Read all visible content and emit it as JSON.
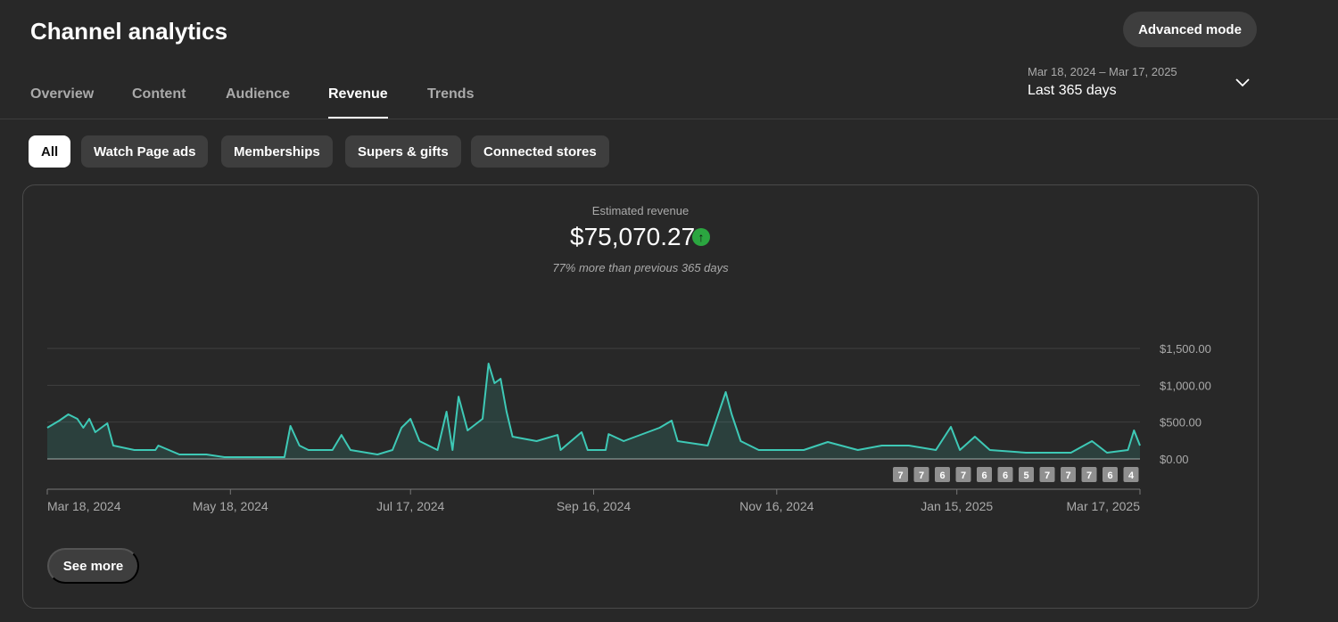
{
  "header": {
    "title": "Channel analytics",
    "advanced_mode": "Advanced mode"
  },
  "tabs": [
    "Overview",
    "Content",
    "Audience",
    "Revenue",
    "Trends"
  ],
  "active_tab": "Revenue",
  "date_range": {
    "dates": "Mar 18, 2024 – Mar 17, 2025",
    "label": "Last 365 days"
  },
  "filters": [
    "All",
    "Watch Page ads",
    "Memberships",
    "Supers & gifts",
    "Connected stores"
  ],
  "metric": {
    "label": "Estimated revenue",
    "value": "$75,070.27",
    "comparison": "77% more than previous 365 days",
    "trend": "up"
  },
  "see_more": "See more",
  "colors": {
    "line": "#3ec9b6",
    "up": "#2ba640"
  },
  "chart_data": {
    "type": "area",
    "x_unit": "day index from Mar 18, 2024",
    "ylim": [
      0,
      1500
    ],
    "y_ticks": [
      {
        "v": 1500,
        "label": "$1,500.00"
      },
      {
        "v": 1000,
        "label": "$1,000.00"
      },
      {
        "v": 500,
        "label": "$500.00"
      },
      {
        "v": 0,
        "label": "$0.00"
      }
    ],
    "x_ticks": [
      {
        "d": 0,
        "label": "Mar 18, 2024"
      },
      {
        "d": 61,
        "label": "May 18, 2024"
      },
      {
        "d": 121,
        "label": "Jul 17, 2024"
      },
      {
        "d": 182,
        "label": "Sep 16, 2024"
      },
      {
        "d": 243,
        "label": "Nov 16, 2024"
      },
      {
        "d": 303,
        "label": "Jan 15, 2025"
      },
      {
        "d": 364,
        "label": "Mar 17, 2025"
      }
    ],
    "points": [
      [
        0,
        423
      ],
      [
        4,
        520
      ],
      [
        7,
        605
      ],
      [
        10,
        544
      ],
      [
        12,
        423
      ],
      [
        14,
        544
      ],
      [
        16,
        363
      ],
      [
        20,
        484
      ],
      [
        22,
        181
      ],
      [
        29,
        121
      ],
      [
        36,
        121
      ],
      [
        37,
        181
      ],
      [
        44,
        60
      ],
      [
        53,
        60
      ],
      [
        59,
        24
      ],
      [
        79,
        24
      ],
      [
        81,
        447
      ],
      [
        84,
        181
      ],
      [
        87,
        121
      ],
      [
        95,
        121
      ],
      [
        98,
        326
      ],
      [
        101,
        121
      ],
      [
        110,
        60
      ],
      [
        115,
        121
      ],
      [
        118,
        423
      ],
      [
        121,
        544
      ],
      [
        124,
        242
      ],
      [
        130,
        121
      ],
      [
        133,
        641
      ],
      [
        135,
        121
      ],
      [
        137,
        846
      ],
      [
        140,
        387
      ],
      [
        145,
        544
      ],
      [
        147,
        1294
      ],
      [
        149,
        1028
      ],
      [
        151,
        1088
      ],
      [
        153,
        641
      ],
      [
        155,
        302
      ],
      [
        163,
        242
      ],
      [
        170,
        326
      ],
      [
        171,
        121
      ],
      [
        178,
        363
      ],
      [
        180,
        121
      ],
      [
        186,
        121
      ],
      [
        187,
        338
      ],
      [
        192,
        242
      ],
      [
        204,
        423
      ],
      [
        208,
        520
      ],
      [
        210,
        242
      ],
      [
        220,
        181
      ],
      [
        226,
        907
      ],
      [
        228,
        605
      ],
      [
        231,
        242
      ],
      [
        237,
        121
      ],
      [
        252,
        121
      ],
      [
        260,
        230
      ],
      [
        270,
        121
      ],
      [
        278,
        181
      ],
      [
        287,
        181
      ],
      [
        296,
        121
      ],
      [
        301,
        435
      ],
      [
        304,
        121
      ],
      [
        309,
        302
      ],
      [
        314,
        121
      ],
      [
        326,
        85
      ],
      [
        341,
        85
      ],
      [
        348,
        242
      ],
      [
        353,
        85
      ],
      [
        360,
        121
      ],
      [
        362,
        387
      ],
      [
        364,
        181
      ]
    ],
    "badges": [
      "7",
      "7",
      "6",
      "7",
      "6",
      "6",
      "5",
      "7",
      "7",
      "7",
      "6",
      "4"
    ]
  }
}
